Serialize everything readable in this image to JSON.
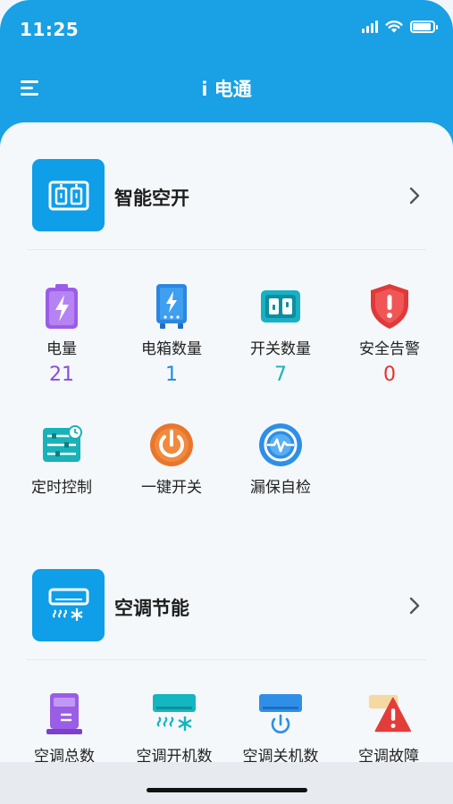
{
  "status_bar": {
    "time": "11:25"
  },
  "nav": {
    "title": "i 电通"
  },
  "section1": {
    "title": "智能空开",
    "stats": [
      {
        "label": "电量",
        "value": "21",
        "color": "#8a4be0",
        "icon": "battery-charge-icon"
      },
      {
        "label": "电箱数量",
        "value": "1",
        "color": "#1a8de6",
        "icon": "electric-box-icon"
      },
      {
        "label": "开关数量",
        "value": "7",
        "color": "#1bb3b3",
        "icon": "switch-panel-icon"
      },
      {
        "label": "安全告警",
        "value": "0",
        "color": "#e8322f",
        "icon": "alert-shield-icon"
      }
    ],
    "actions": [
      {
        "label": "定时控制",
        "icon": "timer-control-icon"
      },
      {
        "label": "一键开关",
        "icon": "power-button-icon"
      },
      {
        "label": "漏保自检",
        "icon": "leak-check-icon"
      }
    ]
  },
  "section2": {
    "title": "空调节能",
    "stats": [
      {
        "label": "空调总数",
        "icon": "ac-unit-total-icon"
      },
      {
        "label": "空调开机数",
        "icon": "ac-on-icon"
      },
      {
        "label": "空调关机数",
        "icon": "ac-off-icon"
      },
      {
        "label": "空调故障",
        "icon": "ac-fault-icon"
      }
    ]
  }
}
